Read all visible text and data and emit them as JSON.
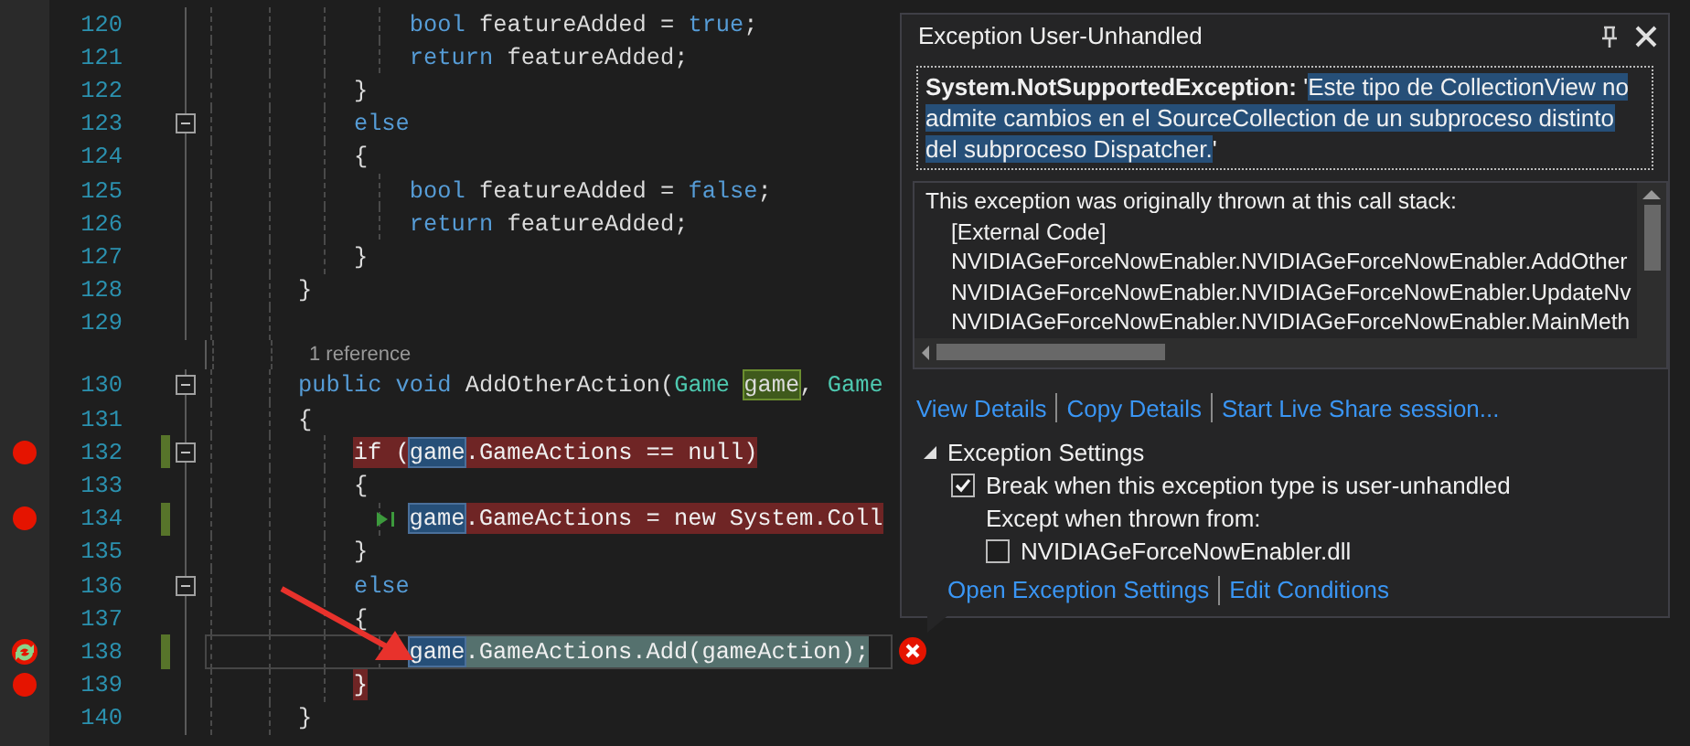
{
  "editor": {
    "lines": [
      {
        "kind": "code",
        "number": "120",
        "tokens": [
          {
            "kind": "keyword",
            "text": "        bool"
          },
          {
            "kind": "plain",
            "text": " featureAdded = "
          },
          {
            "kind": "keyword",
            "text": "true"
          },
          {
            "kind": "plain",
            "text": ";"
          }
        ]
      },
      {
        "kind": "code",
        "number": "121",
        "tokens": [
          {
            "kind": "keyword",
            "text": "        return"
          },
          {
            "kind": "plain",
            "text": " featureAdded;"
          }
        ]
      },
      {
        "kind": "code",
        "number": "122",
        "tokens": [
          {
            "kind": "plain",
            "text": "    }"
          }
        ]
      },
      {
        "kind": "code",
        "number": "123",
        "fold": true,
        "tokens": [
          {
            "kind": "keyword",
            "text": "    else"
          }
        ]
      },
      {
        "kind": "code",
        "number": "124",
        "tokens": [
          {
            "kind": "plain",
            "text": "    {"
          }
        ]
      },
      {
        "kind": "code",
        "number": "125",
        "tokens": [
          {
            "kind": "keyword",
            "text": "        bool"
          },
          {
            "kind": "plain",
            "text": " featureAdded = "
          },
          {
            "kind": "keyword",
            "text": "false"
          },
          {
            "kind": "plain",
            "text": ";"
          }
        ]
      },
      {
        "kind": "code",
        "number": "126",
        "tokens": [
          {
            "kind": "keyword",
            "text": "        return"
          },
          {
            "kind": "plain",
            "text": " featureAdded;"
          }
        ]
      },
      {
        "kind": "code",
        "number": "127",
        "tokens": [
          {
            "kind": "plain",
            "text": "    }"
          }
        ]
      },
      {
        "kind": "code",
        "number": "128",
        "tokens": [
          {
            "kind": "plain",
            "text": "}"
          }
        ]
      },
      {
        "kind": "code",
        "number": "129"
      },
      {
        "kind": "codelens",
        "text": "1 reference"
      },
      {
        "kind": "code",
        "number": "130",
        "fold": true,
        "tokens": [
          {
            "kind": "keyword",
            "text": "public void"
          },
          {
            "kind": "plain",
            "text": " AddOtherAction("
          },
          {
            "kind": "type",
            "text": "Game "
          },
          {
            "kind": "definition",
            "text": "game"
          },
          {
            "kind": "plain",
            "text": ", "
          },
          {
            "kind": "type",
            "text": "Game"
          }
        ]
      },
      {
        "kind": "code",
        "number": "131",
        "tokens": [
          {
            "kind": "plain",
            "text": "{"
          }
        ]
      },
      {
        "kind": "code",
        "number": "132",
        "breakpoint": true,
        "changed": true,
        "fold": true,
        "tokens": [
          {
            "kind": "plain",
            "text": "if ("
          },
          {
            "kind": "reference",
            "text": "game"
          },
          {
            "kind": "plain",
            "text": ".GameActions == null)"
          }
        ]
      },
      {
        "kind": "code",
        "number": "133",
        "tokens": [
          {
            "kind": "plain",
            "text": "    {"
          }
        ]
      },
      {
        "kind": "code",
        "number": "134",
        "breakpoint": true,
        "changed": true,
        "run_to_click": true,
        "tokens": [
          {
            "kind": "reference",
            "text": "game"
          },
          {
            "kind": "plain",
            "text": ".GameActions = new System.Coll"
          }
        ]
      },
      {
        "kind": "code",
        "number": "135",
        "tokens": [
          {
            "kind": "plain",
            "text": "    }"
          }
        ]
      },
      {
        "kind": "code",
        "number": "136",
        "fold": true,
        "tokens": [
          {
            "kind": "keyword",
            "text": "    else"
          }
        ]
      },
      {
        "kind": "code",
        "number": "137",
        "tokens": [
          {
            "kind": "plain",
            "text": "    {"
          }
        ]
      },
      {
        "kind": "code",
        "number": "138",
        "breakpoint": true,
        "current": true,
        "changed": true,
        "error_icon": true,
        "tokens": [
          {
            "kind": "reference",
            "text": "game"
          },
          {
            "kind": "plain",
            "text": ".GameActions.Add(gameAction);"
          }
        ]
      },
      {
        "kind": "code",
        "number": "139",
        "breakpoint": true,
        "tokens": [
          {
            "kind": "plain",
            "text": "}"
          }
        ]
      },
      {
        "kind": "code",
        "number": "140",
        "tokens": [
          {
            "kind": "plain",
            "text": "}"
          }
        ]
      }
    ]
  },
  "exception_popup": {
    "title": "Exception User-Unhandled",
    "message": {
      "type": "System.NotSupportedException:",
      "quote": "'",
      "text": "Este tipo de CollectionView no admite cambios en el SourceCollection de un subproceso distinto del subproceso Dispatcher.",
      "selected": true
    },
    "call_stack": {
      "header": "This exception was originally thrown at this call stack:",
      "frames": [
        "[External Code]",
        "NVIDIAGeForceNowEnabler.NVIDIAGeForceNowEnabler.AddOther",
        "NVIDIAGeForceNowEnabler.NVIDIAGeForceNowEnabler.UpdateNv",
        "NVIDIAGeForceNowEnabler.NVIDIAGeForceNowEnabler.MainMeth"
      ]
    },
    "links": [
      "View Details",
      "Copy Details",
      "Start Live Share session..."
    ],
    "settings": {
      "title": "Exception Settings",
      "expanded": true,
      "break_option": {
        "label": "Break when this exception type is user-unhandled",
        "checked": true
      },
      "except_label": "Except when thrown from:",
      "modules": [
        {
          "label": "NVIDIAGeForceNowEnabler.dll",
          "checked": false
        }
      ]
    },
    "bottom_links": [
      "Open Exception Settings",
      "Edit Conditions"
    ]
  }
}
